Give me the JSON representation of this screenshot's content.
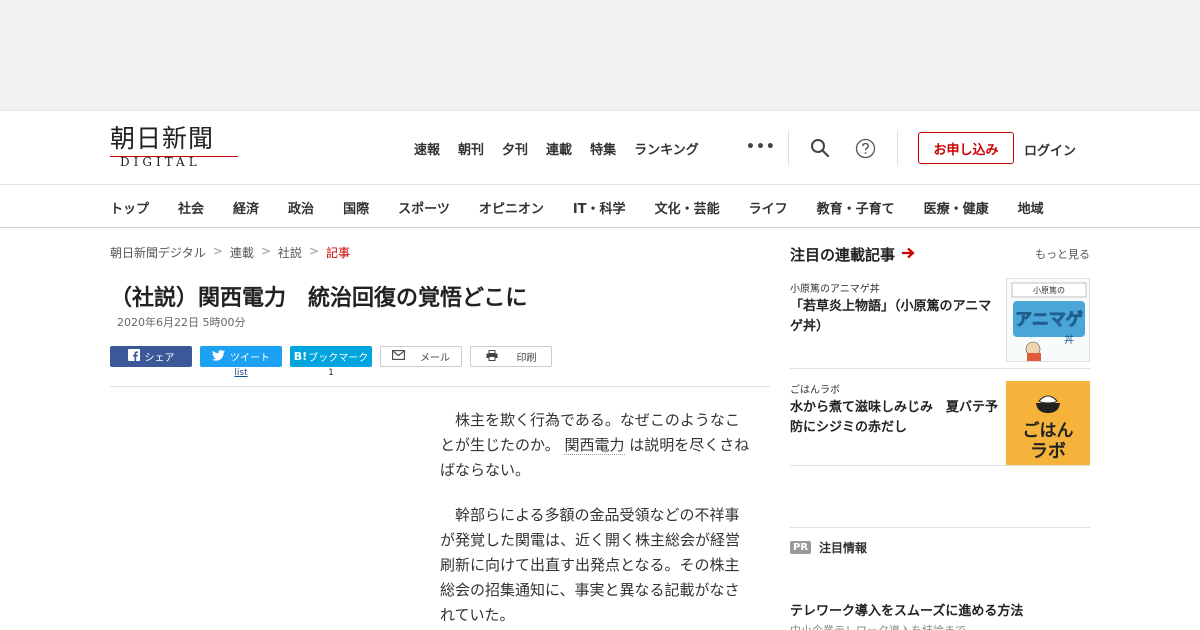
{
  "header": {
    "logo_title": "朝日新聞",
    "logo_sub": "DIGITAL",
    "nav": [
      "速報",
      "朝刊",
      "夕刊",
      "連載",
      "特集",
      "ランキング"
    ],
    "more_label": "•••",
    "apply_label": "お申し込み",
    "login_label": "ログイン"
  },
  "categories": [
    "トップ",
    "社会",
    "経済",
    "政治",
    "国際",
    "スポーツ",
    "オピニオン",
    "IT・科学",
    "文化・芸能",
    "ライフ",
    "教育・子育て",
    "医療・健康",
    "地域"
  ],
  "breadcrumb": {
    "items": [
      "朝日新聞デジタル",
      "連載",
      "社説"
    ],
    "current": "記事",
    "separator": ">"
  },
  "article": {
    "headline": "（社説）関西電力　統治回復の覚悟どこに",
    "date": "2020年6月22日 5時00分",
    "paragraphs": [
      {
        "before": "株主を欺く行為である。なぜこのようなことが生じたのか。",
        "keyword": "関西電力",
        "after": "は説明を尽くさねばならない。"
      },
      {
        "before": "幹部らによる多額の金品受領などの不祥事が発覚した関電は、近く開く株主総会が経営刷新に向けて出直す出発点となる。その株主総会の招集通知に、事実と異なる記載がなされていた。",
        "keyword": "",
        "after": ""
      }
    ]
  },
  "share": {
    "facebook": "シェア",
    "twitter": "ツイート",
    "twitter_count": "list",
    "hatena": "ブックマーク",
    "hatena_prefix": "B!",
    "hatena_count": "1",
    "mail": "メール",
    "print": "印刷"
  },
  "sidebar": {
    "title": "注目の連載記事",
    "more": "もっと見る",
    "cards": [
      {
        "series": "小原篤のアニマゲ丼",
        "title": "「若草炎上物語」（小原篤のアニマゲ丼）",
        "thumb_top": "小原篤の",
        "thumb_main": "アニマゲ",
        "thumb_sub": "丼"
      },
      {
        "series": "ごはんラボ",
        "title": "水から煮て滋味しみじみ　夏バテ予防にシジミの赤だし",
        "thumb_line1": "ごはん",
        "thumb_line2": "ラボ"
      }
    ]
  },
  "pr": {
    "badge": "PR",
    "label": "注目情報",
    "title": "テレワーク導入をスムーズに進める方法",
    "sub": "中小企業テレワーク導入を結論まで"
  },
  "colors": {
    "accent": "#cc0000",
    "facebook": "#3b5998",
    "twitter": "#1da1f2",
    "hatena": "#00a4de",
    "gohan_bg": "#f5b33b"
  }
}
